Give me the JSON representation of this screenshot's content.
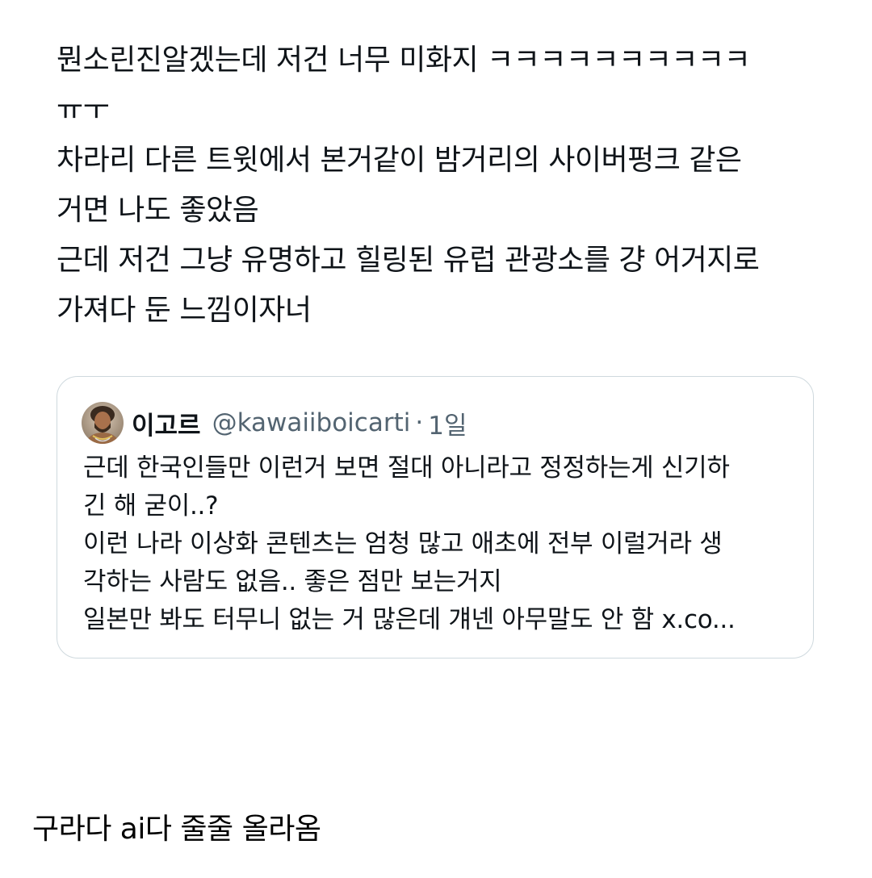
{
  "tweet": {
    "lines": [
      "뭔소린진알겠는데 저건 너무 미화지 ㅋㅋㅋㅋㅋㅋㅋㅋㅋㅋ",
      "ㅠㅜ",
      "차라리 다른 트윗에서 본거같이 밤거리의 사이버펑크 같은",
      "거면 나도 좋았음",
      "근데 저건 그냥 유명하고 힐링된 유럽 관광소를 걍 어거지로",
      "가져다 둔 느낌이자너"
    ]
  },
  "quote": {
    "author_name": "이고르",
    "author_handle": "@kawaiiboicarti",
    "separator": "·",
    "time": "1일",
    "lines": [
      "근데 한국인들만 이런거 보면 절대 아니라고 정정하는게 신기하",
      "긴 해 굳이..?",
      "이런 나라 이상화 콘텐츠는 엄청 많고 애초에 전부 이럴거라 생",
      "각하는 사람도 없음.. 좋은 점만 보는거지",
      "일본만 봐도 터무니 없는 거 많은데 걔넨 아무말도 안 함 x.co..."
    ]
  },
  "caption": "구라다 ai다 줄줄 올라옴"
}
